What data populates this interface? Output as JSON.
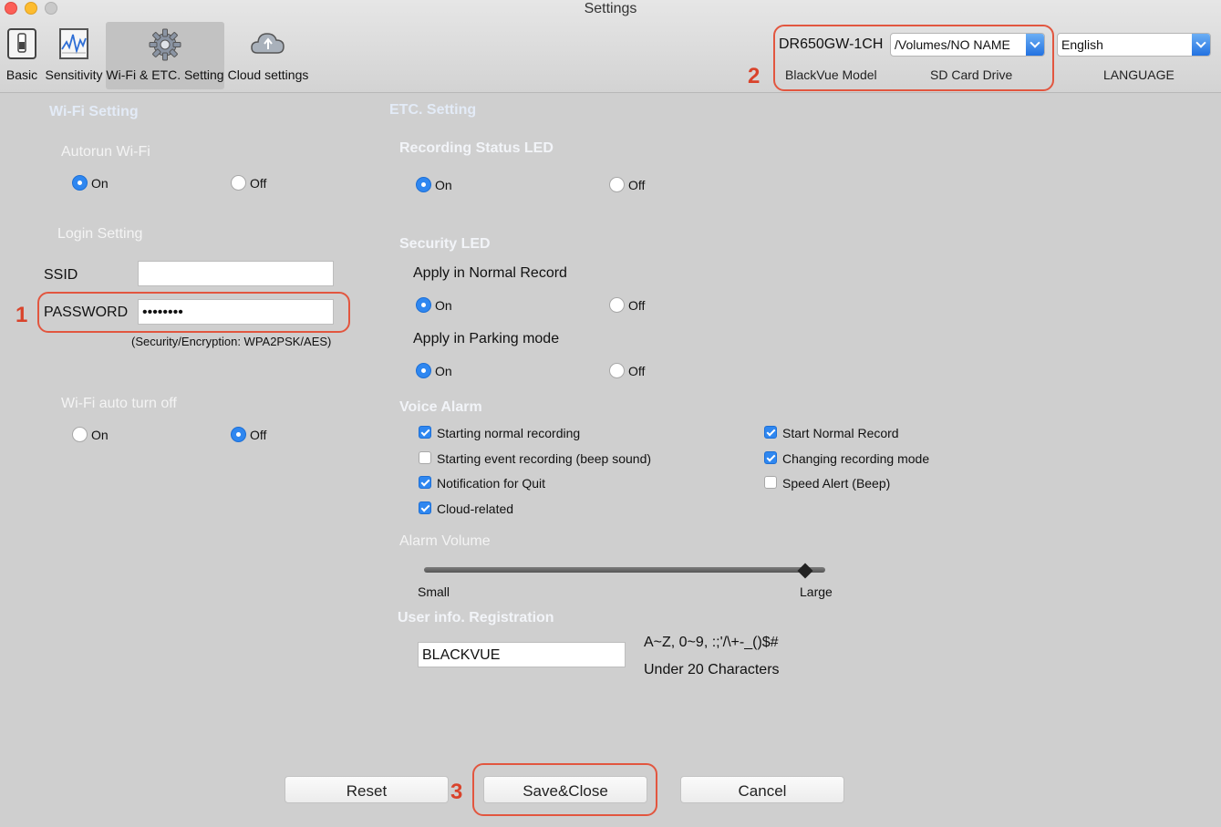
{
  "window": {
    "title": "Settings"
  },
  "toolbar": {
    "items": [
      {
        "label": "Basic"
      },
      {
        "label": "Sensitivity"
      },
      {
        "label": "Wi-Fi & ETC. Setting"
      },
      {
        "label": "Cloud settings"
      }
    ],
    "active_index": 2
  },
  "device": {
    "model_value": "DR650GW-1CH",
    "model_label": "BlackVue Model",
    "sd_card_value": "/Volumes/NO NAME",
    "sd_card_label": "SD Card Drive",
    "language_value": "English",
    "language_label": "LANGUAGE"
  },
  "callouts": {
    "one": "1",
    "two": "2",
    "three": "3"
  },
  "wifi": {
    "section_title": "Wi-Fi Setting",
    "autorun_title": "Autorun Wi-Fi",
    "autorun_on": "On",
    "autorun_off": "Off",
    "autorun_selected": "on",
    "login_title": "Login Setting",
    "ssid_label": "SSID",
    "ssid_value": "",
    "password_label": "PASSWORD",
    "password_value": "••••••••",
    "encryption_note": "(Security/Encryption: WPA2PSK/AES)",
    "auto_off_title": "Wi-Fi auto turn off",
    "auto_off_on": "On",
    "auto_off_off": "Off",
    "auto_off_selected": "off"
  },
  "etc": {
    "section_title": "ETC. Setting",
    "rec_led_title": "Recording Status LED",
    "rec_led_on": "On",
    "rec_led_off": "Off",
    "rec_led_selected": "on",
    "security_led_title": "Security LED",
    "normal_record_title": "Apply in Normal Record",
    "normal_on": "On",
    "normal_off": "Off",
    "normal_selected": "on",
    "parking_title": "Apply in Parking mode",
    "parking_on": "On",
    "parking_off": "Off",
    "parking_selected": "on",
    "voice_alarm_title": "Voice Alarm",
    "voice_items": [
      {
        "label": "Starting normal recording",
        "checked": true
      },
      {
        "label": "Starting event recording (beep sound)",
        "checked": false
      },
      {
        "label": "Notification for Quit",
        "checked": true
      },
      {
        "label": "Cloud-related",
        "checked": true
      },
      {
        "label": "Start Normal Record",
        "checked": true
      },
      {
        "label": "Changing recording mode",
        "checked": true
      },
      {
        "label": "Speed Alert (Beep)",
        "checked": false
      }
    ],
    "alarm_volume_title": "Alarm Volume",
    "volume_min_label": "Small",
    "volume_max_label": "Large",
    "volume_level": 0.95,
    "user_info_title": "User info. Registration",
    "user_info_value": "BLACKVUE",
    "user_info_rule": "A~Z, 0~9, :;'/\\+-_()$#",
    "user_info_limit": "Under 20 Characters"
  },
  "buttons": {
    "reset": "Reset",
    "save": "Save&Close",
    "cancel": "Cancel"
  },
  "colors": {
    "accent": "#2f87f0",
    "callout": "#e2563f",
    "background": "#cfcfcf"
  }
}
